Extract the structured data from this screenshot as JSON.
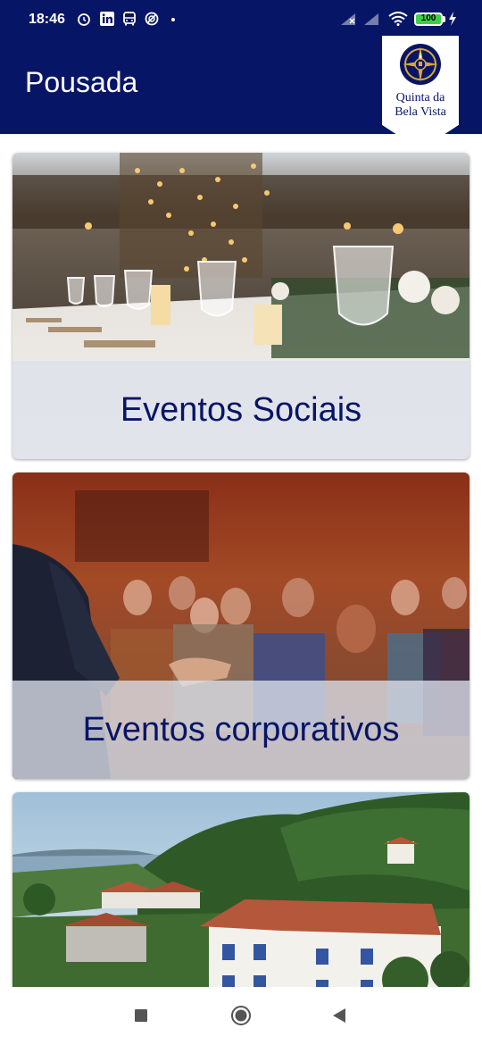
{
  "status_bar": {
    "time": "18:46",
    "battery": "100",
    "left_icons": [
      "alarm-icon",
      "linkedin-icon",
      "bus-icon",
      "vpn-icon",
      "dot-icon"
    ],
    "right_icons": [
      "signal-icon",
      "signal-icon",
      "wifi-icon",
      "battery-icon",
      "charging-icon"
    ]
  },
  "app_bar": {
    "title": "Pousada",
    "logo_line1": "Quinta da",
    "logo_line2": "Bela Vista"
  },
  "cards": [
    {
      "label": "Eventos Sociais"
    },
    {
      "label": "Eventos corporativos"
    }
  ],
  "nav_bar": {
    "icons": [
      "recents-square-icon",
      "home-circle-icon",
      "back-triangle-icon"
    ]
  },
  "colors": {
    "primary": "#071566",
    "label_text": "#071566",
    "label_band": "#dce0ea"
  }
}
